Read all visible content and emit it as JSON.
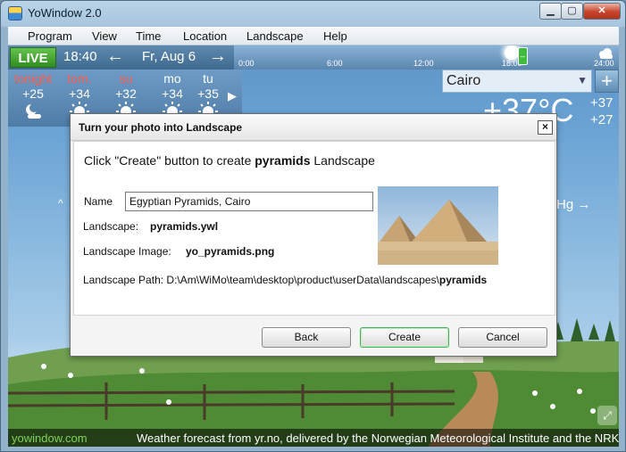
{
  "window": {
    "title": "YoWindow 2.0",
    "min_glyph": "▁",
    "max_glyph": "▢",
    "close_glyph": "✕"
  },
  "menu": [
    "Program",
    "View",
    "Time",
    "Location",
    "Landscape",
    "Help"
  ],
  "toolbar": {
    "live_label": "LIVE",
    "time": "18:40",
    "prev_glyph": "←",
    "next_glyph": "→",
    "date": "Fr, Aug 6",
    "timeline_ticks": [
      "0:00",
      "6:00",
      "12:00",
      "18:00",
      "24:00"
    ],
    "timeline_marker_glyph": "↔"
  },
  "forecast": {
    "days": [
      {
        "name": "tonight",
        "temp": "+25",
        "icon": "moon-cloud-icon",
        "weekend": true
      },
      {
        "name": "tom.",
        "temp": "+34",
        "icon": "sun-icon",
        "weekend": true
      },
      {
        "name": "su",
        "temp": "+32",
        "icon": "sun-icon",
        "weekend": true
      },
      {
        "name": "mo",
        "temp": "+34",
        "icon": "sun-icon",
        "weekend": false
      },
      {
        "name": "tu",
        "temp": "+35",
        "icon": "sun-icon",
        "weekend": false
      }
    ],
    "next_glyph": "▶"
  },
  "current": {
    "city": "Cairo",
    "city_caret": "▼",
    "add_glyph": "+",
    "temp": "+37°C",
    "hi": "+37",
    "lo": "+27",
    "pressure_unit": "Hg →",
    "side_caret": "^"
  },
  "status": {
    "link": "yowindow.com",
    "credit": "Weather forecast from yr.no, delivered by the Norwegian Meteorological Institute and the NRK",
    "grip_glyph": "⤢"
  },
  "dialog": {
    "title": "Turn your photo into Landscape",
    "close_glyph": "×",
    "intro_prefix": "Click \"Create\" button to create ",
    "intro_bold": "pyramids",
    "intro_suffix": " Landscape",
    "name_label": "Name",
    "name_value": "Egyptian Pyramids, Cairo",
    "landscape_label": "Landscape:",
    "landscape_value": "pyramids.ywl",
    "image_label": "Landscape Image:",
    "image_value": "yo_pyramids.png",
    "path_label": "Landscape Path: ",
    "path_value": "D:\\Am\\WiMo\\team\\desktop\\product\\userData\\landscapes\\",
    "path_bold": "pyramids",
    "buttons": {
      "back": "Back",
      "create": "Create",
      "cancel": "Cancel"
    }
  }
}
